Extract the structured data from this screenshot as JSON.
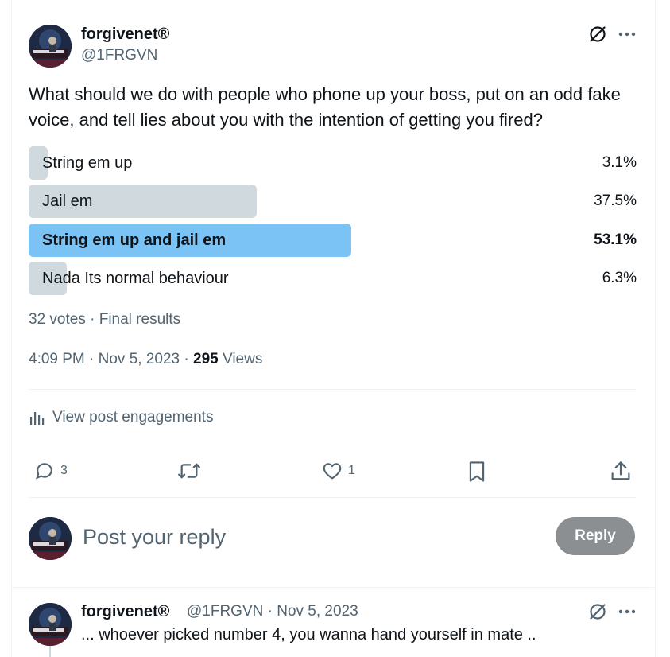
{
  "post": {
    "author_name": "forgivenet®",
    "author_handle": "@1FRGVN",
    "text": "What should we do with people who phone up your boss, put on an odd fake voice, and tell lies about you with the intention of getting you fired?"
  },
  "poll": {
    "options": [
      {
        "label": "String em up",
        "percent": "3.1%",
        "fraction": 0.031,
        "winner": false
      },
      {
        "label": "Jail em",
        "percent": "37.5%",
        "fraction": 0.375,
        "winner": false
      },
      {
        "label": "String em up and jail em",
        "percent": "53.1%",
        "fraction": 0.531,
        "winner": true
      },
      {
        "label": "Nada Its normal behaviour",
        "percent": "6.3%",
        "fraction": 0.063,
        "winner": false
      }
    ],
    "summary": "32 votes · Final results"
  },
  "meta": {
    "time": "4:09 PM · Nov 5, 2023 ·",
    "views_count": "295",
    "views_label": "Views"
  },
  "engagements_link": "View post engagements",
  "actions": {
    "reply_count": "3",
    "like_count": "1"
  },
  "composer": {
    "placeholder": "Post your reply",
    "button_label": "Reply"
  },
  "reply": {
    "author_name": "forgivenet®",
    "author_handle_date": "@1FRGVN · Nov 5, 2023",
    "text": "... whoever picked number 4, you wanna hand yourself in mate .."
  },
  "colors": {
    "accent": "#1d9bf0",
    "winner_bar": "#7cc3f5",
    "bar": "#cfd9de",
    "muted_text": "#536471",
    "reply_button": "#8b8f92"
  },
  "icons": {
    "grok": "slashed-circle-icon",
    "more": "more-dots-icon",
    "analytics": "bar-chart-icon",
    "reply": "speech-bubble-icon",
    "repost": "repost-arrows-icon",
    "like": "heart-icon",
    "bookmark": "bookmark-icon",
    "share": "share-upload-icon"
  }
}
